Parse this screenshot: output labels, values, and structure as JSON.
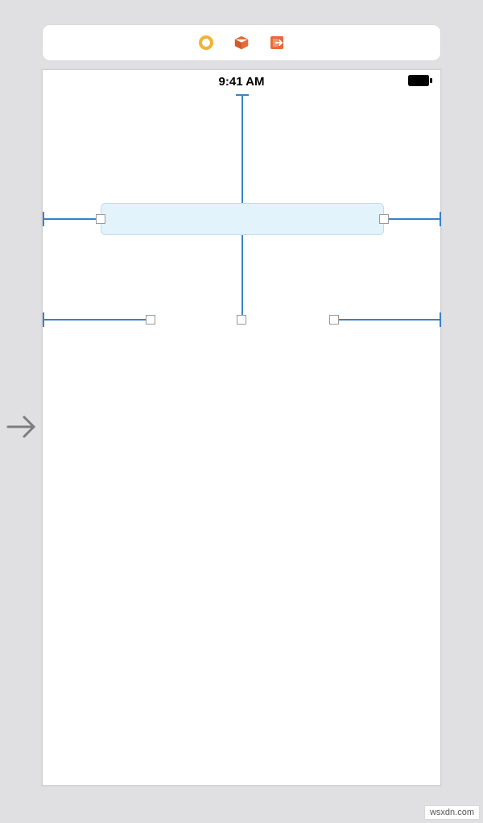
{
  "toolbar": {
    "icons": [
      "circle-icon",
      "cube-icon",
      "exit-icon"
    ]
  },
  "status_bar": {
    "time": "9:41 AM"
  },
  "selected_element": {
    "type": "text-field"
  },
  "colors": {
    "guide": "#3b82c4",
    "selection_fill": "#e3f3fb",
    "toolbar_orange": "#e86a3a",
    "toolbar_yellow": "#f0b434"
  },
  "watermark": "wsxdn.com"
}
